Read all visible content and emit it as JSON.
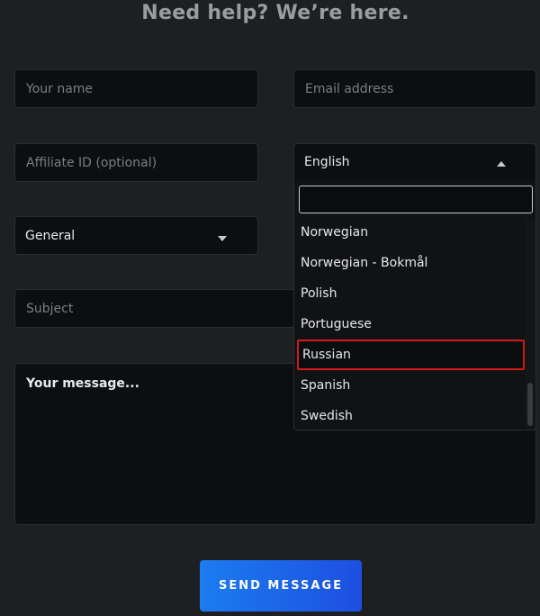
{
  "heading": "Need help? We’re here.",
  "form": {
    "name_placeholder": "Your name",
    "email_placeholder": "Email address",
    "affiliate_placeholder": "Affiliate ID (optional)",
    "subject_placeholder": "Subject",
    "message_placeholder": "Your message...",
    "language_selected": "English",
    "category_selected": "General",
    "send_label": "SEND MESSAGE"
  },
  "language_dropdown": {
    "search_value": "",
    "options": [
      "Norwegian",
      "Norwegian - Bokmål",
      "Polish",
      "Portuguese",
      "Russian",
      "Spanish",
      "Swedish"
    ],
    "highlighted": "Russian"
  },
  "colors": {
    "background": "#1e1f22",
    "field_background": "#0d0e10",
    "button_gradient_start": "#1c7cf0",
    "button_gradient_end": "#1d4fe0",
    "highlight_border": "#d11b1b"
  }
}
